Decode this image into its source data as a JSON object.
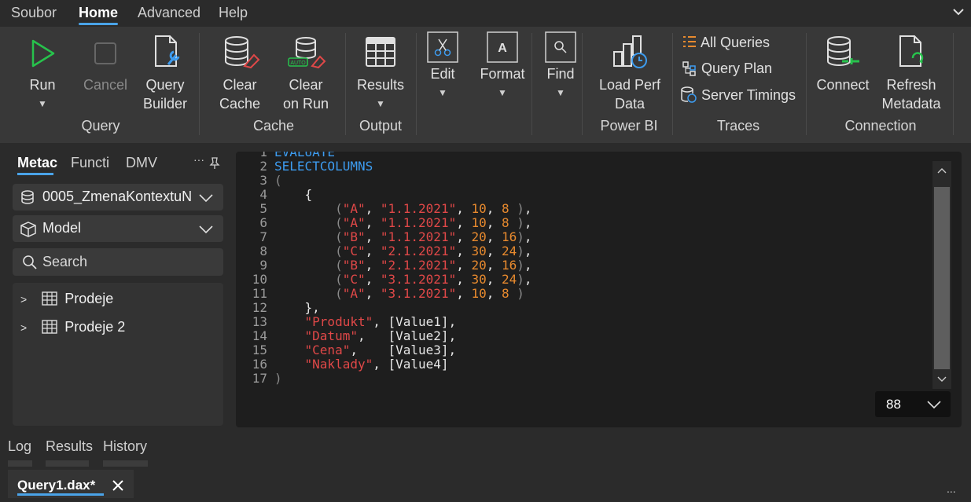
{
  "menu": {
    "items": [
      "Soubor",
      "Home",
      "Advanced",
      "Help"
    ],
    "active": "Home"
  },
  "ribbon": {
    "run": {
      "label": "Run"
    },
    "cancel": {
      "label": "Cancel"
    },
    "query_builder": {
      "line1": "Query",
      "line2": "Builder"
    },
    "group_query": "Query",
    "clear_cache": {
      "line1": "Clear",
      "line2": "Cache"
    },
    "clear_on_run": {
      "line1": "Clear",
      "line2": "on Run",
      "badge": "AUTO"
    },
    "group_cache": "Cache",
    "results": {
      "label": "Results"
    },
    "group_output": "Output",
    "edit": {
      "label": "Edit"
    },
    "format": {
      "label": "Format",
      "glyph": "A"
    },
    "find": {
      "label": "Find"
    },
    "load_perf": {
      "line1": "Load Perf",
      "line2": "Data"
    },
    "group_powerbi": "Power BI",
    "all_queries": "All Queries",
    "query_plan": "Query Plan",
    "server_timings": "Server Timings",
    "group_traces": "Traces",
    "connect": {
      "label": "Connect"
    },
    "refresh_metadata": {
      "line1": "Refresh",
      "line2": "Metadata"
    },
    "group_connection": "Connection"
  },
  "left_panel": {
    "tabs": [
      "Metac",
      "Functi",
      "DMV"
    ],
    "active_tab": "Metac",
    "database": "0005_ZmenaKontextuN",
    "model": "Model",
    "search_placeholder": "Search",
    "tables": [
      "Prodeje",
      "Prodeje 2"
    ]
  },
  "editor": {
    "lines": [
      "EVALUATE",
      "SELECTCOLUMNS",
      "(",
      "    {",
      "        (\"A\", \"1.1.2021\", 10, 8 ),",
      "        (\"A\", \"1.1.2021\", 10, 8 ),",
      "        (\"B\", \"1.1.2021\", 20, 16),",
      "        (\"C\", \"2.1.2021\", 30, 24),",
      "        (\"B\", \"2.1.2021\", 20, 16),",
      "        (\"C\", \"3.1.2021\", 30, 24),",
      "        (\"A\", \"3.1.2021\", 10, 8 )",
      "    },",
      "    \"Produkt\", [Value1],",
      "    \"Datum\",   [Value2],",
      "    \"Cena\",    [Value3],",
      "    \"Naklady\", [Value4]",
      ")"
    ],
    "zoom": "88"
  },
  "bottom_tabs": [
    "Log",
    "Results",
    "History"
  ],
  "document_tab": {
    "title": "Query1.dax*"
  },
  "more": "..."
}
